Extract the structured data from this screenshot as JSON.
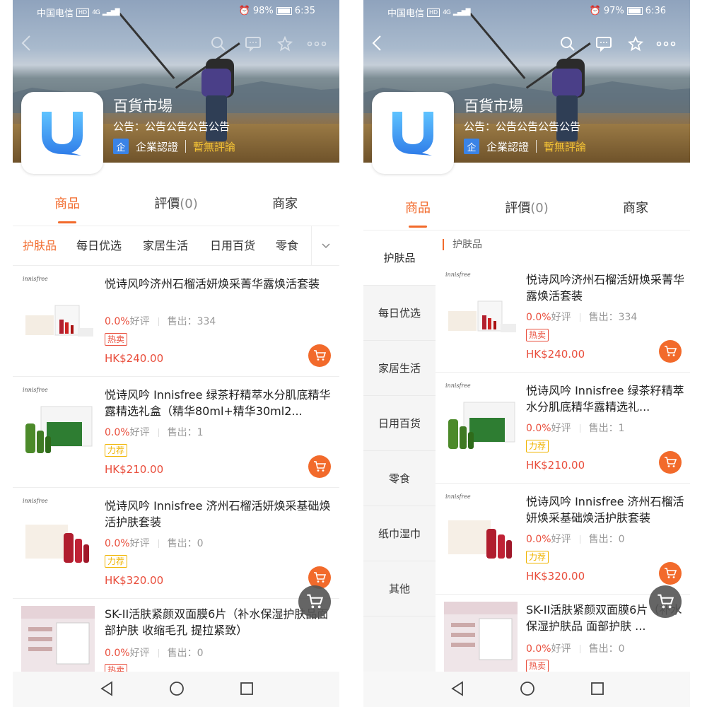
{
  "screens": [
    {
      "status": {
        "carrier": "中国电信",
        "hd": "HD",
        "net": "4G",
        "battery": "98%",
        "time": "6:35"
      },
      "shop": {
        "title": "百貨市場",
        "notice": "公告：公告公告公告公告",
        "enterprise_badge": "企",
        "enterprise_label": "企業認證",
        "review_status": "暫無評論"
      },
      "tabs": [
        {
          "label": "商品",
          "count": ""
        },
        {
          "label": "評價",
          "count": "(0)"
        },
        {
          "label": "商家",
          "count": ""
        }
      ],
      "categories": [
        "护肤品",
        "每日优选",
        "家居生活",
        "日用百货",
        "零食"
      ],
      "products": [
        {
          "brand": "innisfree",
          "name": "悦诗风吟济州石榴活妍焕采菁华露焕活套装",
          "rate": "0.0%",
          "rate_label": "好评",
          "sold": "售出：334",
          "tag": "热卖",
          "tag_type": "hot",
          "price": "HK$240.00"
        },
        {
          "brand": "innisfree",
          "name": "悦诗风吟 Innisfree 绿茶籽精萃水分肌底精华露精选礼盒（精华80ml+精华30ml2...",
          "rate": "0.0%",
          "rate_label": "好评",
          "sold": "售出：1",
          "tag": "力荐",
          "tag_type": "rec",
          "price": "HK$210.00"
        },
        {
          "brand": "innisfree",
          "name": "悦诗风吟 Innisfree 济州石榴活妍焕采基础焕活护肤套装",
          "rate": "0.0%",
          "rate_label": "好评",
          "sold": "售出：0",
          "tag": "力荐",
          "tag_type": "rec",
          "price": "HK$320.00"
        },
        {
          "brand": "",
          "name": "SK-II活肤紧颜双面膜6片（补水保湿护肤品面部护肤 收缩毛孔 提拉紧致）",
          "rate": "0.0%",
          "rate_label": "好评",
          "sold": "售出：0",
          "tag": "热卖",
          "tag_type": "hot",
          "price": ""
        }
      ]
    },
    {
      "status": {
        "carrier": "中国电信",
        "hd": "HD",
        "net": "4G",
        "battery": "97%",
        "time": "6:36"
      },
      "shop": {
        "title": "百貨市場",
        "notice": "公告：公告公告公告公告",
        "enterprise_badge": "企",
        "enterprise_label": "企業認證",
        "review_status": "暫無評論"
      },
      "tabs": [
        {
          "label": "商品",
          "count": ""
        },
        {
          "label": "評價",
          "count": "(0)"
        },
        {
          "label": "商家",
          "count": ""
        }
      ],
      "section_title": "护肤品",
      "sidebar": [
        "护肤品",
        "每日优选",
        "家居生活",
        "日用百货",
        "零食",
        "纸巾湿巾",
        "其他"
      ],
      "products": [
        {
          "brand": "innisfree",
          "name": "悦诗风吟济州石榴活妍焕采菁华露焕活套装",
          "rate": "0.0%",
          "rate_label": "好评",
          "sold": "售出：334",
          "tag": "热卖",
          "tag_type": "hot",
          "price": "HK$240.00"
        },
        {
          "brand": "innisfree",
          "name": "悦诗风吟 Innisfree 绿茶籽精萃水分肌底精华露精选礼...",
          "rate": "0.0%",
          "rate_label": "好评",
          "sold": "售出：1",
          "tag": "力荐",
          "tag_type": "rec",
          "price": "HK$210.00"
        },
        {
          "brand": "innisfree",
          "name": "悦诗风吟 Innisfree 济州石榴活妍焕采基础焕活护肤套装",
          "rate": "0.0%",
          "rate_label": "好评",
          "sold": "售出：0",
          "tag": "力荐",
          "tag_type": "rec",
          "price": "HK$320.00"
        },
        {
          "brand": "",
          "name": "SK-II活肤紧颜双面膜6片（补水保湿护肤品 面部护肤 ...",
          "rate": "0.0%",
          "rate_label": "好评",
          "sold": "售出：0",
          "tag": "热卖",
          "tag_type": "hot",
          "price": ""
        }
      ]
    }
  ],
  "icons": {
    "back": "back-icon",
    "search": "search-icon",
    "message": "message-icon",
    "favorite": "star-icon",
    "more": "more-icon",
    "cart": "cart-icon",
    "expand": "chevron-down-icon",
    "nav_back": "triangle-back-icon",
    "nav_home": "circle-home-icon",
    "nav_recent": "square-recent-icon"
  },
  "colors": {
    "accent": "#f26a2b",
    "price": "#e94e3c",
    "recommend": "#f0b400",
    "verify": "#3a83e6"
  }
}
